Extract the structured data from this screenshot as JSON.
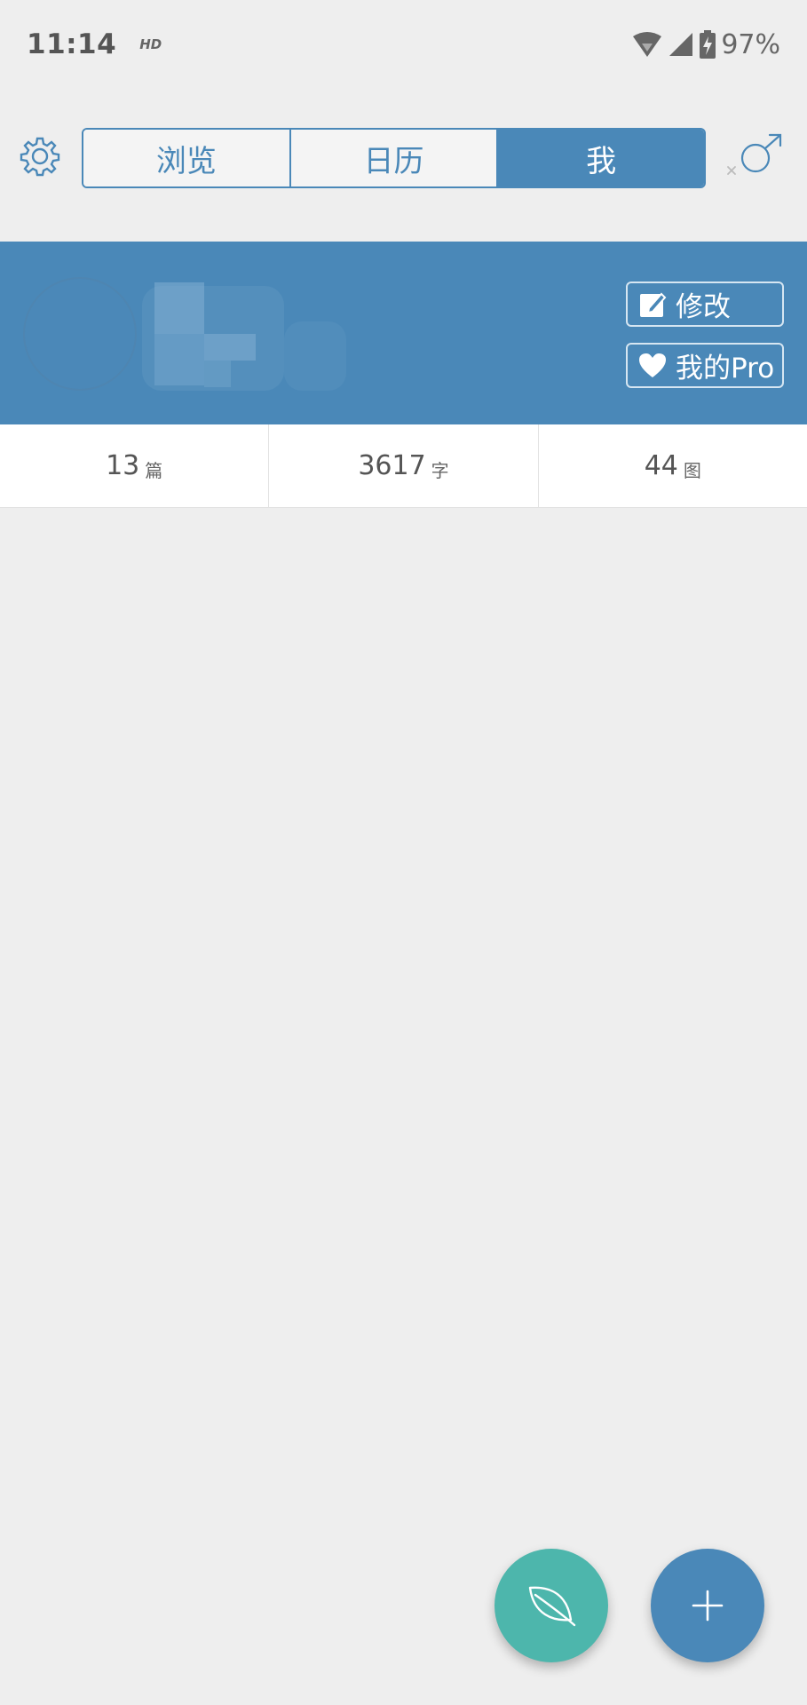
{
  "status_bar": {
    "time": "11:14",
    "hd_label": "HD",
    "battery_percent": "97%"
  },
  "nav": {
    "tabs": [
      {
        "label": "浏览",
        "active": false
      },
      {
        "label": "日历",
        "active": false
      },
      {
        "label": "我",
        "active": true
      }
    ]
  },
  "profile": {
    "edit_label": "修改",
    "pro_label": "我的Pro"
  },
  "stats": [
    {
      "value": "13",
      "unit": "篇"
    },
    {
      "value": "3617",
      "unit": "字"
    },
    {
      "value": "44",
      "unit": "图"
    }
  ],
  "colors": {
    "primary": "#4a88b8",
    "teal": "#4db6ac",
    "background": "#eeeeee"
  },
  "icons": {
    "settings": "gear-icon",
    "gender": "male-symbol-icon",
    "leaf": "leaf-icon",
    "add": "plus-icon"
  }
}
